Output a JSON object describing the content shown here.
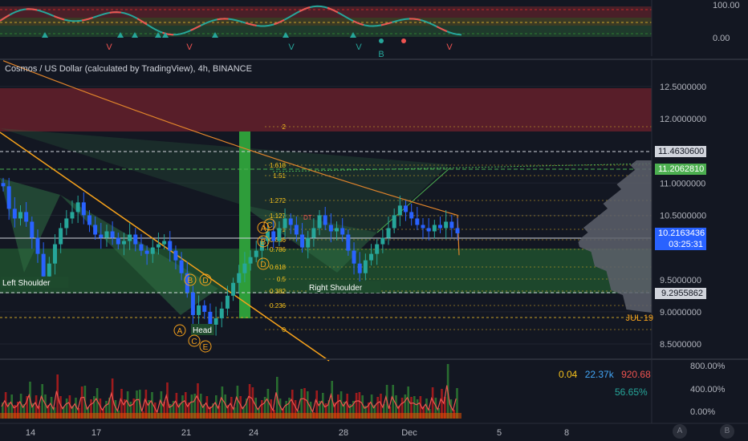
{
  "title": "Cosmos / US Dollar (calculated by TradingView), 4h, BINANCE",
  "osc": {
    "ticks": [
      "100.00",
      "0.00"
    ],
    "letters": [
      "V",
      "V",
      "V",
      "V",
      "V",
      "B"
    ]
  },
  "price_axis": {
    "ticks": [
      "12.5000000",
      "12.0000000",
      "11.0000000",
      "10.5000000",
      "9.5000000",
      "9.0000000",
      "8.5000000"
    ],
    "tags": {
      "level_a": "11.4630600",
      "level_b": "11.2062810",
      "last_price": "10.2163436",
      "countdown": "03:25:31",
      "level_c": "9.2955862",
      "jul19": "JUL 19"
    }
  },
  "pattern_labels": [
    "Left Shoulder",
    "Head",
    "Right Shoulder"
  ],
  "points": [
    "A",
    "B",
    "C",
    "D",
    "E"
  ],
  "fib_labels": [
    "2",
    "1.618",
    "1.51",
    "1.272",
    "1.127",
    "DT",
    "1",
    "0.886",
    "0.786",
    "0.618",
    "0.5",
    "0.382",
    "0.236",
    "0"
  ],
  "volume_pane": {
    "stats": [
      "0.04",
      "22.37k",
      "920.68",
      "56.65%"
    ],
    "ticks": [
      "800.00%",
      "400.00%",
      "0.00%"
    ]
  },
  "time_axis": [
    "14",
    "17",
    "21",
    "24",
    "28",
    "Dec",
    "5",
    "8"
  ],
  "corner_buttons": [
    "A",
    "B"
  ],
  "chart_data": {
    "type": "candlestick",
    "title": "Cosmos / US Dollar (calculated by TradingView), 4h, BINANCE",
    "x_ticks": [
      "14",
      "17",
      "21",
      "24",
      "28",
      "Dec",
      "5",
      "8"
    ],
    "y_ticks": [
      12.5,
      12.0,
      11.0,
      10.5,
      9.5,
      9.0,
      8.5
    ],
    "ylim": [
      8.3,
      12.9
    ],
    "last_price": 10.2163436,
    "levels": [
      11.46306,
      11.206281,
      9.2955862
    ],
    "close_path": [
      10.95,
      10.6,
      10.45,
      10.55,
      10.4,
      10.15,
      9.9,
      9.55,
      9.75,
      10.05,
      10.3,
      10.45,
      10.55,
      10.7,
      10.5,
      10.35,
      10.2,
      10.15,
      10.25,
      10.15,
      10.05,
      10.1,
      10.2,
      10.05,
      9.95,
      9.9,
      10.0,
      10.05,
      10.1,
      9.95,
      9.8,
      9.6,
      9.3,
      8.95,
      9.1,
      9.0,
      8.8,
      8.9,
      9.05,
      9.25,
      9.45,
      9.6,
      9.75,
      9.85,
      9.95,
      10.1,
      10.25,
      10.1,
      10.3,
      10.45,
      10.35,
      10.2,
      10.0,
      10.15,
      10.3,
      10.5,
      10.35,
      10.25,
      10.3,
      10.2,
      9.95,
      9.75,
      9.6,
      9.8,
      9.9,
      10.05,
      10.15,
      10.3,
      10.5,
      10.65,
      10.55,
      10.45,
      10.35,
      10.3,
      10.25,
      10.35,
      10.3,
      10.4,
      10.3,
      10.22
    ]
  }
}
